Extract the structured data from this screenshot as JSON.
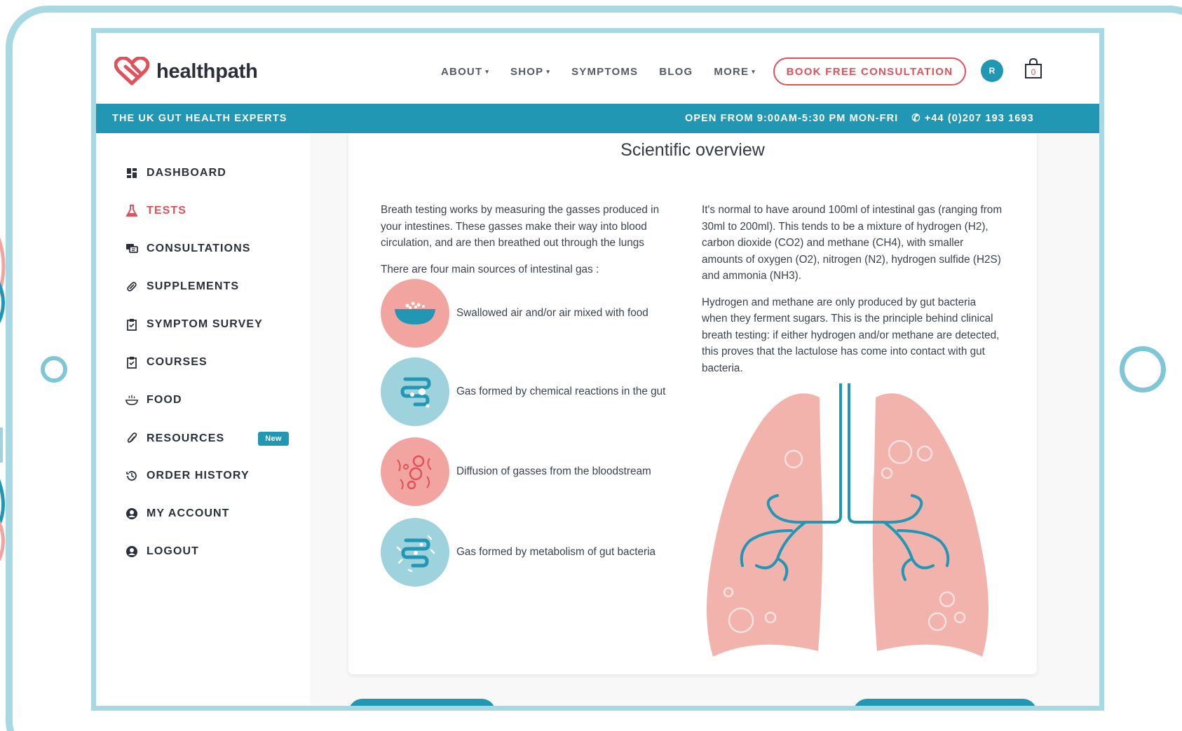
{
  "brand": {
    "name": "healthpath"
  },
  "nav": {
    "items": [
      {
        "label": "ABOUT",
        "caret": true
      },
      {
        "label": "SHOP",
        "caret": true
      },
      {
        "label": "SYMPTOMS",
        "caret": false
      },
      {
        "label": "BLOG",
        "caret": false
      },
      {
        "label": "MORE",
        "caret": true
      }
    ],
    "cta_label": "BOOK FREE CONSULTATION",
    "avatar_initial": "R",
    "cart_count": "0"
  },
  "infobar": {
    "tagline": "THE UK GUT HEALTH EXPERTS",
    "hours": "OPEN FROM 9:00AM-5:30 PM MON-FRI",
    "phone": "+44 (0)207 193 1693"
  },
  "sidebar": {
    "items": [
      {
        "label": "DASHBOARD",
        "icon": "dashboard-icon",
        "active": false
      },
      {
        "label": "TESTS",
        "icon": "flask-icon",
        "active": true
      },
      {
        "label": "CONSULTATIONS",
        "icon": "chat-icon",
        "active": false
      },
      {
        "label": "SUPPLEMENTS",
        "icon": "pill-icon",
        "active": false
      },
      {
        "label": "SYMPTOM SURVEY",
        "icon": "clipboard-icon",
        "active": false
      },
      {
        "label": "COURSES",
        "icon": "clipboard-icon",
        "active": false
      },
      {
        "label": "FOOD",
        "icon": "bowl-icon",
        "active": false
      },
      {
        "label": "RESOURCES",
        "icon": "paperclip-icon",
        "active": false,
        "badge": "New"
      },
      {
        "label": "ORDER HISTORY",
        "icon": "history-icon",
        "active": false
      },
      {
        "label": "MY ACCOUNT",
        "icon": "user-icon",
        "active": false
      },
      {
        "label": "LOGOUT",
        "icon": "user-icon",
        "active": false
      }
    ]
  },
  "content": {
    "title": "Scientific overview",
    "left_intro": "Breath testing works by measuring the gasses produced in your intestines. These gasses make their way into blood circulation, and are then breathed out through the lungs",
    "left_sources_intro": "There are four main sources of intestinal gas :",
    "sources": [
      {
        "label": "Swallowed air and/or air mixed with food",
        "icon": "food-bowl-icon"
      },
      {
        "label": "Gas formed by chemical reactions in the gut",
        "icon": "intestine-icon"
      },
      {
        "label": "Diffusion of gasses from the bloodstream",
        "icon": "blood-cells-icon"
      },
      {
        "label": "Gas formed by metabolism of gut bacteria",
        "icon": "bacteria-icon"
      }
    ],
    "right_p1": "It's normal to have around 100ml of intestinal gas (ranging from 30ml to 200ml). This tends to be a mixture of hydrogen (H2), carbon dioxide (CO2) and methane (CH4), with smaller amounts of oxygen (O2), nitrogen (N2), hydrogen sulfide (H2S) and ammonia (NH3).",
    "right_p2": "Hydrogen and methane are only produced by gut bacteria when they ferment sugars. This is the principle behind clinical breath testing: if either hydrogen and/or methane are detected, this proves that the lactulose has come into contact with gut bacteria."
  },
  "colors": {
    "accent_blue": "#2197b3",
    "accent_red": "#e0515a",
    "pink": "#f2a5a0",
    "light_blue": "#9ed2dc",
    "frame": "#a8d8e2"
  }
}
